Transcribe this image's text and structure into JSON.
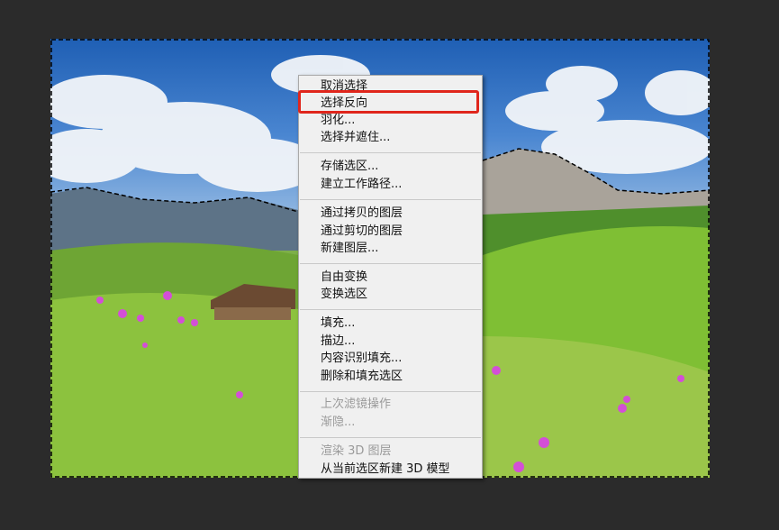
{
  "menu": {
    "items": [
      {
        "label": "取消选择",
        "enabled": true
      },
      {
        "label": "选择反向",
        "enabled": true,
        "highlighted": true
      },
      {
        "label": "羽化...",
        "enabled": true
      },
      {
        "label": "选择并遮住...",
        "enabled": true
      },
      {
        "label": "存储选区...",
        "enabled": true
      },
      {
        "label": "建立工作路径...",
        "enabled": true
      },
      {
        "label": "通过拷贝的图层",
        "enabled": true
      },
      {
        "label": "通过剪切的图层",
        "enabled": true
      },
      {
        "label": "新建图层...",
        "enabled": true
      },
      {
        "label": "自由变换",
        "enabled": true
      },
      {
        "label": "变换选区",
        "enabled": true
      },
      {
        "label": "填充...",
        "enabled": true
      },
      {
        "label": "描边...",
        "enabled": true
      },
      {
        "label": "内容识别填充...",
        "enabled": true
      },
      {
        "label": "删除和填充选区",
        "enabled": true
      },
      {
        "label": "上次滤镜操作",
        "enabled": false
      },
      {
        "label": "渐隐...",
        "enabled": false
      },
      {
        "label": "渲染 3D 图层",
        "enabled": false
      },
      {
        "label": "从当前选区新建 3D 模型",
        "enabled": true
      }
    ]
  },
  "colors": {
    "background": "#2b2b2b",
    "menu_bg": "#f0f0f0",
    "highlight": "#e0261c",
    "disabled_text": "#9a9a9a"
  }
}
